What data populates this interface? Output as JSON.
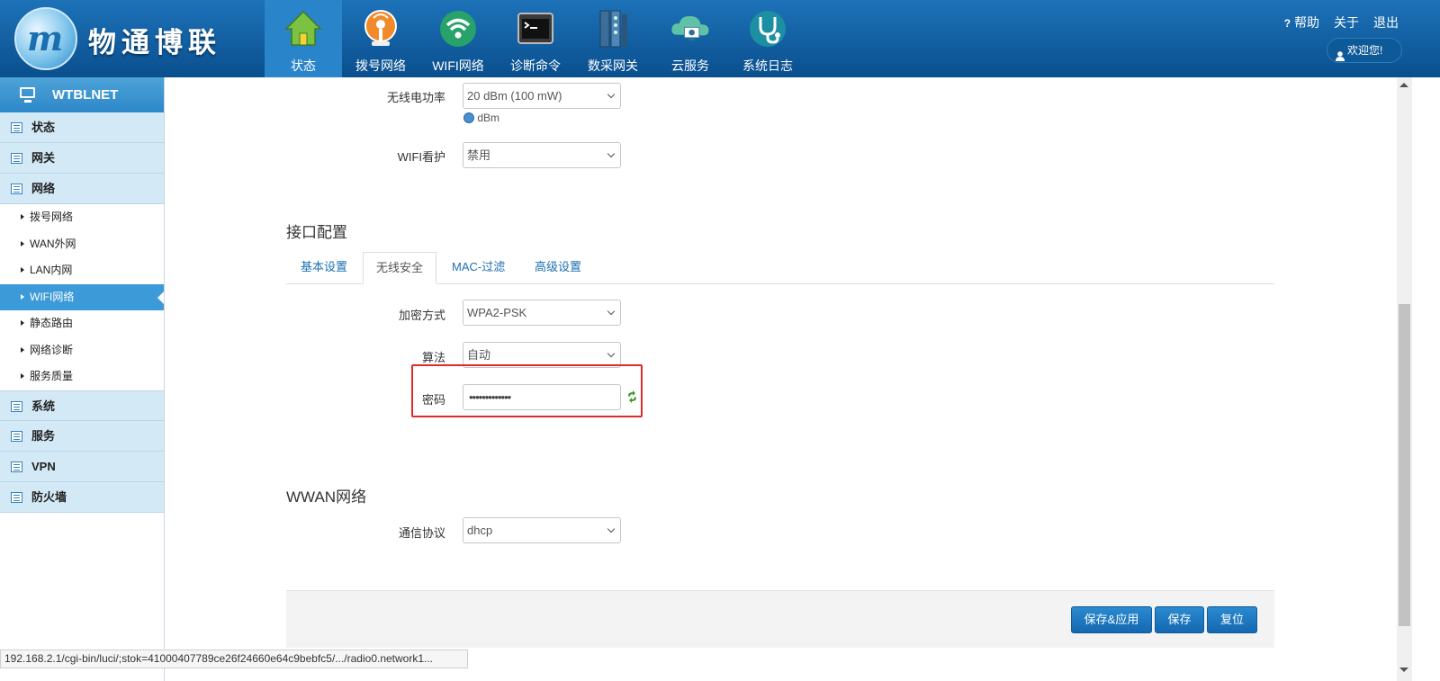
{
  "header": {
    "brand_name": "物通博联",
    "nav": [
      {
        "label": "状态",
        "icon": "home-icon"
      },
      {
        "label": "拨号网络",
        "icon": "dial-icon"
      },
      {
        "label": "WIFI网络",
        "icon": "wifi-icon"
      },
      {
        "label": "诊断命令",
        "icon": "terminal-icon"
      },
      {
        "label": "数采网关",
        "icon": "gateway-icon"
      },
      {
        "label": "云服务",
        "icon": "cloud-icon"
      },
      {
        "label": "系统日志",
        "icon": "stethoscope-icon"
      }
    ],
    "help": "帮助",
    "about": "关于",
    "logout": "退出",
    "welcome": "欢迎您!"
  },
  "sidebar": {
    "title": "WTBLNET",
    "categories_top": [
      "状态",
      "网关",
      "网络"
    ],
    "network_items": [
      "拨号网络",
      "WAN外网",
      "LAN内网",
      "WIFI网络",
      "静态路由",
      "网络诊断",
      "服务质量"
    ],
    "active_item": "WIFI网络",
    "categories_bottom": [
      "系统",
      "服务",
      "VPN",
      "防火墙"
    ]
  },
  "form": {
    "tx_power_label": "无线电功率",
    "tx_power_value": "20 dBm (100 mW)",
    "tx_power_hint": "dBm",
    "wifi_guard_label": "WIFI看护",
    "wifi_guard_value": "禁用",
    "interface_title": "接口配置",
    "tabs": [
      "基本设置",
      "无线安全",
      "MAC-过滤",
      "高级设置"
    ],
    "active_tab": "无线安全",
    "encryption_label": "加密方式",
    "encryption_value": "WPA2-PSK",
    "cipher_label": "算法",
    "cipher_value": "自动",
    "key_label": "密码",
    "key_value": "•••••••••••••",
    "wwan_title": "WWAN网络",
    "protocol_label": "通信协议",
    "protocol_value": "dhcp"
  },
  "buttons": {
    "save_apply": "保存&应用",
    "save": "保存",
    "reset": "复位"
  },
  "status_url": "192.168.2.1/cgi-bin/luci/;stok=41000407789ce26f24660e64c9bebfc5/.../radio0.network1..."
}
